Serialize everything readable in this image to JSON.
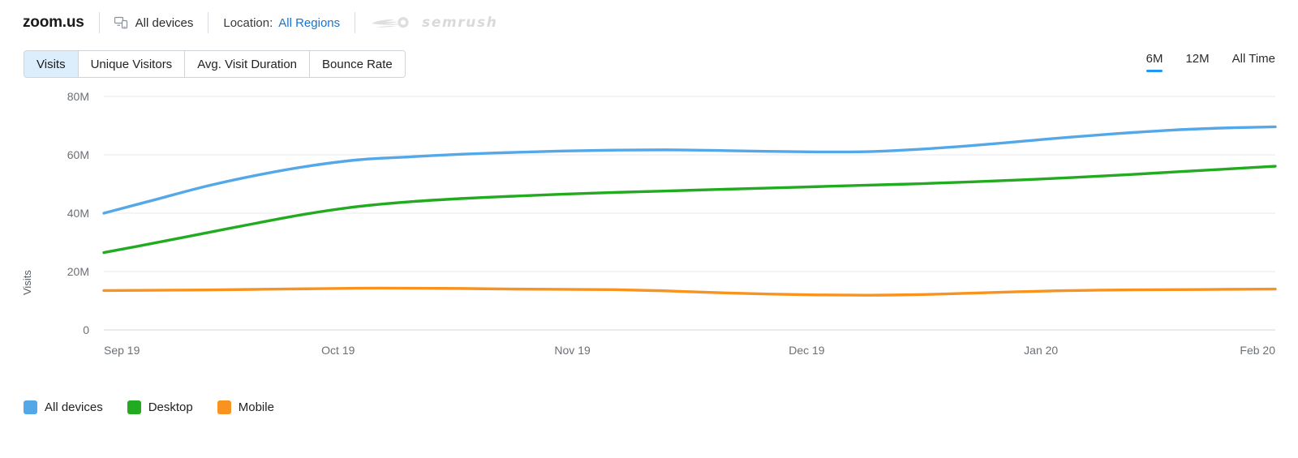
{
  "header": {
    "site_title": "zoom.us",
    "device_filter": "All devices",
    "device_icon": "devices-icon",
    "location_label": "Location:",
    "location_value": "All Regions",
    "brand_logo": "semrush-logo",
    "brand_name": "semrush"
  },
  "tabs": [
    {
      "label": "Visits",
      "active": true
    },
    {
      "label": "Unique Visitors",
      "active": false
    },
    {
      "label": "Avg. Visit Duration",
      "active": false
    },
    {
      "label": "Bounce Rate",
      "active": false
    }
  ],
  "ranges": [
    {
      "label": "6M",
      "active": true
    },
    {
      "label": "12M",
      "active": false
    },
    {
      "label": "All Time",
      "active": false
    }
  ],
  "colors": {
    "all_devices": "#55a8e8",
    "desktop": "#22ab20",
    "mobile": "#f7931e",
    "accent": "#2196f3",
    "link": "#1a73cc",
    "grid": "#e8eaec",
    "axis_text": "#6b7075"
  },
  "chart_data": {
    "type": "line",
    "title": "",
    "xlabel": "",
    "ylabel": "Visits",
    "ylim": [
      0,
      80000000
    ],
    "yticks": [
      0,
      20000000,
      40000000,
      60000000,
      80000000
    ],
    "ytick_labels": [
      "0",
      "20M",
      "40M",
      "60M",
      "80M"
    ],
    "grid": true,
    "legend_position": "bottom-left",
    "x": [
      "Sep 19",
      "Oct 19",
      "Nov 19",
      "Dec 19",
      "Jan 20",
      "Feb 20"
    ],
    "x_tick_labels": [
      "Sep 19",
      "Oct 19",
      "Nov 19",
      "Dec 19",
      "Jan 20",
      "Feb 20"
    ],
    "series": [
      {
        "name": "All devices",
        "color": "#55a8e8",
        "values": [
          40000000,
          58800000,
          61500000,
          61000000,
          64800000,
          69500000
        ],
        "dense_values": [
          40000000,
          44600000,
          49200000,
          53000000,
          56100000,
          58300000,
          59300000,
          60200000,
          60800000,
          61300000,
          61600000,
          61700000,
          61500000,
          61200000,
          61000000,
          61100000,
          61900000,
          63100000,
          64600000,
          66100000,
          67400000,
          68500000,
          69200000,
          69600000
        ]
      },
      {
        "name": "Desktop",
        "color": "#22ab20",
        "values": [
          26500000,
          44800000,
          47600000,
          49600000,
          51600000,
          56000000
        ],
        "dense_values": [
          26500000,
          29800000,
          33200000,
          36600000,
          39800000,
          42300000,
          43900000,
          45000000,
          45800000,
          46500000,
          47100000,
          47600000,
          48100000,
          48600000,
          49100000,
          49600000,
          50100000,
          50700000,
          51400000,
          52200000,
          53100000,
          54100000,
          55100000,
          56100000
        ]
      },
      {
        "name": "Mobile",
        "color": "#f7931e",
        "values": [
          13500000,
          14300000,
          13900000,
          11900000,
          13600000,
          13900000
        ],
        "dense_values": [
          13500000,
          13600000,
          13700000,
          13900000,
          14100000,
          14300000,
          14300000,
          14200000,
          14000000,
          13900000,
          13800000,
          13400000,
          12800000,
          12300000,
          12000000,
          11900000,
          12100000,
          12600000,
          13100000,
          13500000,
          13700000,
          13800000,
          13900000,
          14000000
        ]
      }
    ]
  },
  "legend": [
    {
      "label": "All devices",
      "color": "#55a8e8"
    },
    {
      "label": "Desktop",
      "color": "#22ab20"
    },
    {
      "label": "Mobile",
      "color": "#f7931e"
    }
  ]
}
